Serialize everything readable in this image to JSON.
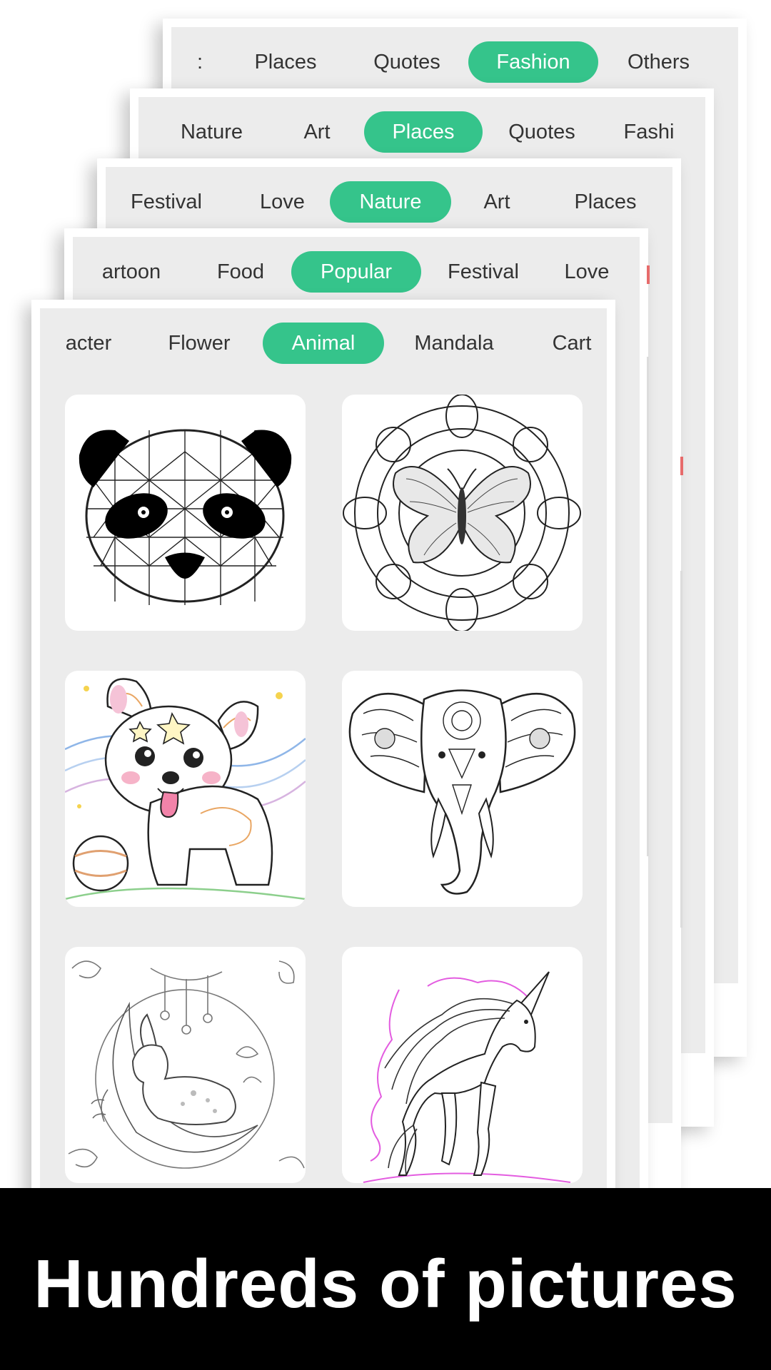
{
  "screens": [
    {
      "tabs": [
        ":",
        "Places",
        "Quotes",
        "Fashion",
        "Others"
      ],
      "active": "Fashion"
    },
    {
      "tabs": [
        "Nature",
        "Art",
        "Places",
        "Quotes",
        "Fashi"
      ],
      "active": "Places"
    },
    {
      "tabs": [
        "Festival",
        "Love",
        "Nature",
        "Art",
        "Places"
      ],
      "active": "Nature"
    },
    {
      "tabs": [
        "artoon",
        "Food",
        "Popular",
        "Festival",
        "Love"
      ],
      "active": "Popular"
    },
    {
      "tabs": [
        "acter",
        "Flower",
        "Animal",
        "Mandala",
        "Cart"
      ],
      "active": "Animal"
    }
  ],
  "gallery": [
    {
      "name": "panda",
      "icon": "panda-geometric-picture"
    },
    {
      "name": "butterfly-mandala",
      "icon": "butterfly-mandala-picture"
    },
    {
      "name": "corgi",
      "icon": "corgi-puppy-picture"
    },
    {
      "name": "elephant",
      "icon": "mandala-elephant-picture"
    },
    {
      "name": "fawn-moon",
      "icon": "fawn-on-moon-picture"
    },
    {
      "name": "unicorn",
      "icon": "unicorn-picture"
    }
  ],
  "colors": {
    "accent": "#35c48b",
    "panel": "#ececec",
    "banner": "#000000"
  },
  "banner": {
    "caption": "Hundreds of pictures"
  }
}
